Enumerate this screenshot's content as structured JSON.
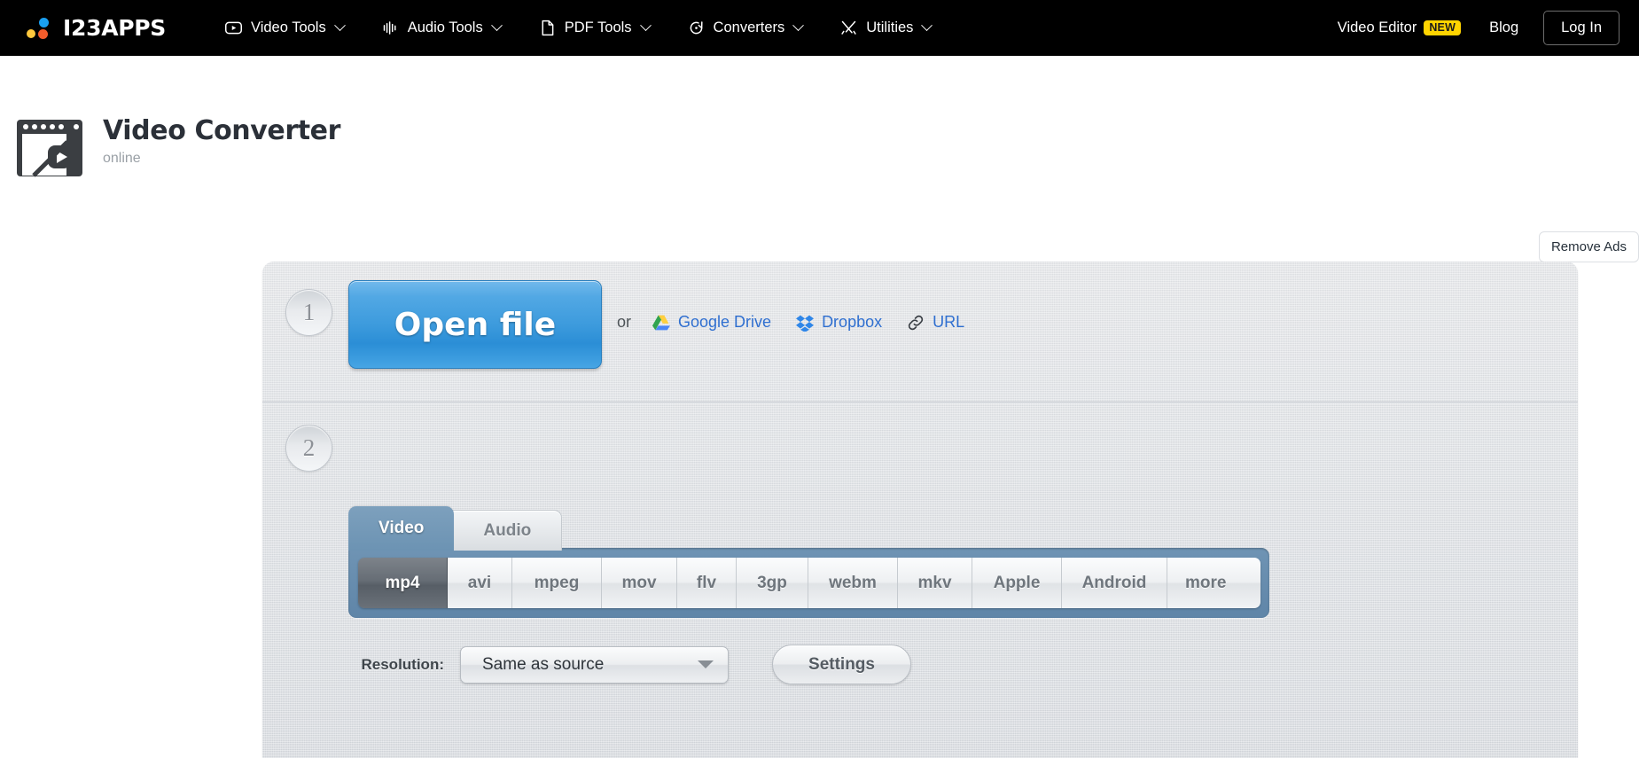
{
  "navbar": {
    "brand": "I23APPS",
    "items": [
      {
        "label": "Video Tools",
        "icon": "video-play-icon",
        "caret": true
      },
      {
        "label": "Audio Tools",
        "icon": "audio-wave-icon",
        "caret": true
      },
      {
        "label": "PDF Tools",
        "icon": "document-icon",
        "caret": true
      },
      {
        "label": "Converters",
        "icon": "convert-refresh-icon",
        "caret": true
      },
      {
        "label": "Utilities",
        "icon": "tools-cross-icon",
        "caret": true
      }
    ],
    "video_editor": "Video Editor",
    "new_badge": "NEW",
    "blog": "Blog",
    "login": "Log In"
  },
  "header": {
    "title": "Video Converter",
    "subtitle": "online",
    "remove_ads": "Remove Ads"
  },
  "step1": {
    "number": "1",
    "open_file": "Open file",
    "or": "or",
    "sources": [
      {
        "label": "Google Drive",
        "icon": "google-drive-icon"
      },
      {
        "label": "Dropbox",
        "icon": "dropbox-icon"
      },
      {
        "label": "URL",
        "icon": "link-icon"
      }
    ]
  },
  "step2": {
    "number": "2",
    "tabs": [
      {
        "label": "Video",
        "active": true
      },
      {
        "label": "Audio",
        "active": false
      }
    ],
    "formats": [
      {
        "label": "mp4",
        "selected": true
      },
      {
        "label": "avi",
        "selected": false
      },
      {
        "label": "mpeg",
        "selected": false
      },
      {
        "label": "mov",
        "selected": false
      },
      {
        "label": "flv",
        "selected": false
      },
      {
        "label": "3gp",
        "selected": false
      },
      {
        "label": "webm",
        "selected": false
      },
      {
        "label": "mkv",
        "selected": false
      },
      {
        "label": "Apple",
        "selected": false
      },
      {
        "label": "Android",
        "selected": false
      }
    ],
    "more_label": "more",
    "resolution_label": "Resolution:",
    "resolution_value": "Same as source",
    "settings_label": "Settings"
  },
  "colors": {
    "nav_bg": "#000000",
    "accent_blue": "#3d9bdd",
    "badge_yellow": "#ffd400",
    "tab_active_blue": "#6c93b3",
    "panel_gray": "#dcdfe3",
    "link_blue": "#2f6fd0"
  }
}
